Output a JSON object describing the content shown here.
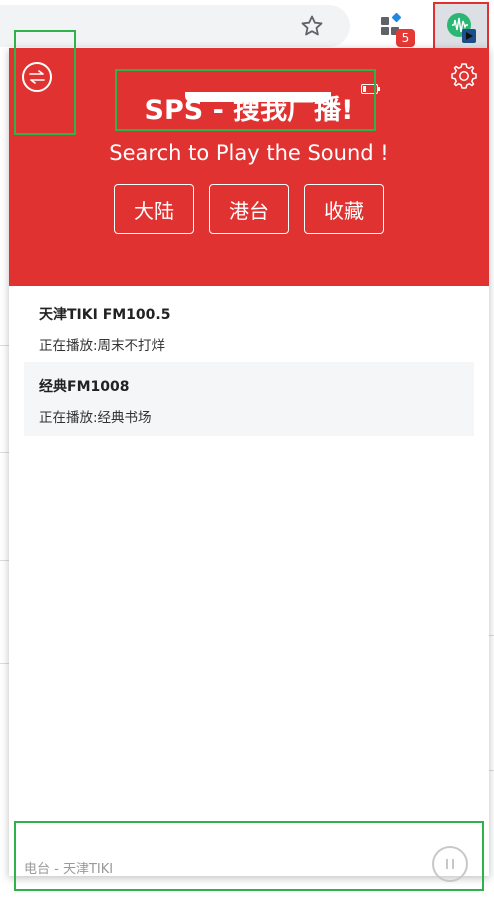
{
  "browser": {
    "extension_badge": "5"
  },
  "popup": {
    "title": "SPS - 搜我广播!",
    "subtitle": "Search to Play the Sound !",
    "region_buttons": [
      {
        "label": "大陆"
      },
      {
        "label": "港台"
      },
      {
        "label": "收藏"
      }
    ],
    "stations": [
      {
        "name": "天津TIKI FM100.5",
        "now_playing": "正在播放:周末不打烊"
      },
      {
        "name": "经典FM1008",
        "now_playing": "正在播放:经典书场"
      }
    ],
    "player": {
      "now_playing": "电台 - 天津TIKI"
    }
  },
  "colors": {
    "header_red": "#e03331",
    "highlight_green": "#2fb24b"
  },
  "icons": [
    "star-icon",
    "extensions-icon",
    "sps-extension-icon",
    "switch-icon",
    "gear-icon",
    "battery-icon",
    "pause-icon"
  ]
}
